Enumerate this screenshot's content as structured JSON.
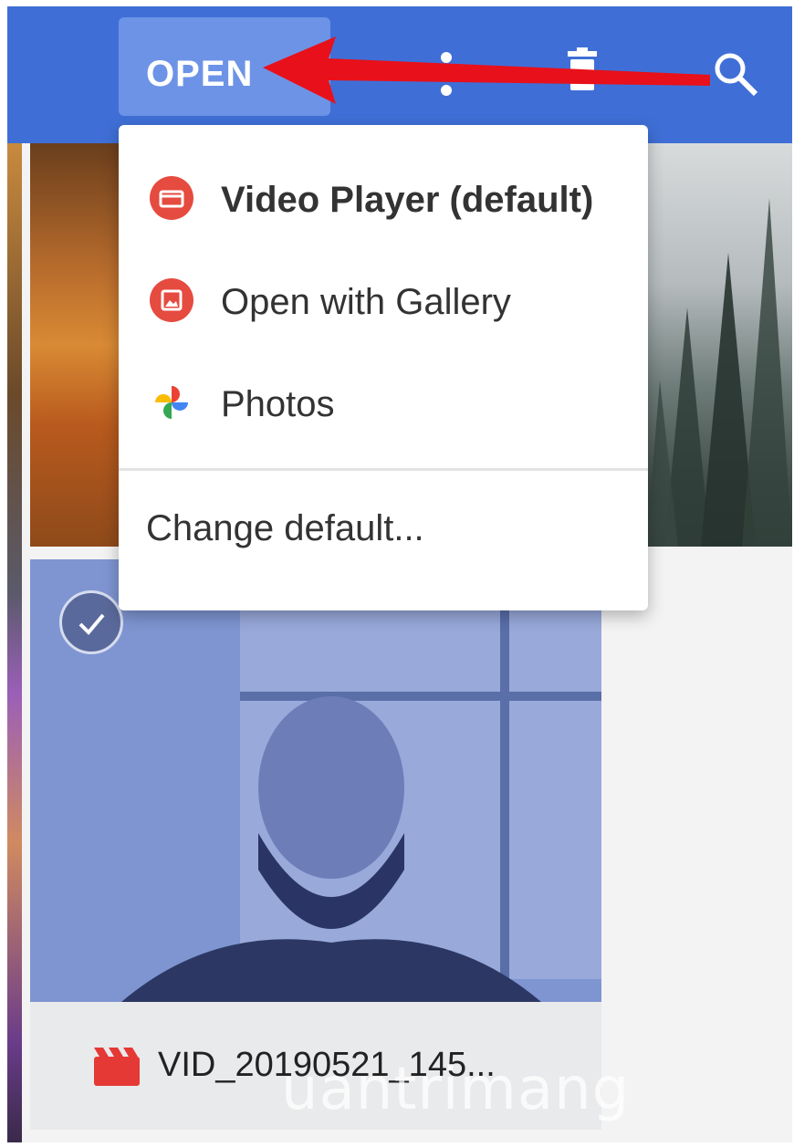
{
  "toolbar": {
    "open_label": "OPEN",
    "icons": [
      "share-icon",
      "trash-icon",
      "search-icon"
    ]
  },
  "menu": {
    "items": [
      {
        "label": "Video Player (default)",
        "icon": "video-player-icon",
        "bold": true,
        "icon_color": "#e54b3f"
      },
      {
        "label": "Open with Gallery",
        "icon": "gallery-icon",
        "bold": false,
        "icon_color": "#e54b3f"
      },
      {
        "label": "Photos",
        "icon": "google-photos-icon",
        "bold": false
      }
    ],
    "change_default": "Change default..."
  },
  "files": {
    "selected_video_name": "VID_20190521_145..."
  },
  "watermark": "uantrimang",
  "colors": {
    "toolbar": "#3f6fd6",
    "open_button": "#6d93e6",
    "selection_overlay": "#7f95d2",
    "annotation_arrow": "#e8101a"
  }
}
